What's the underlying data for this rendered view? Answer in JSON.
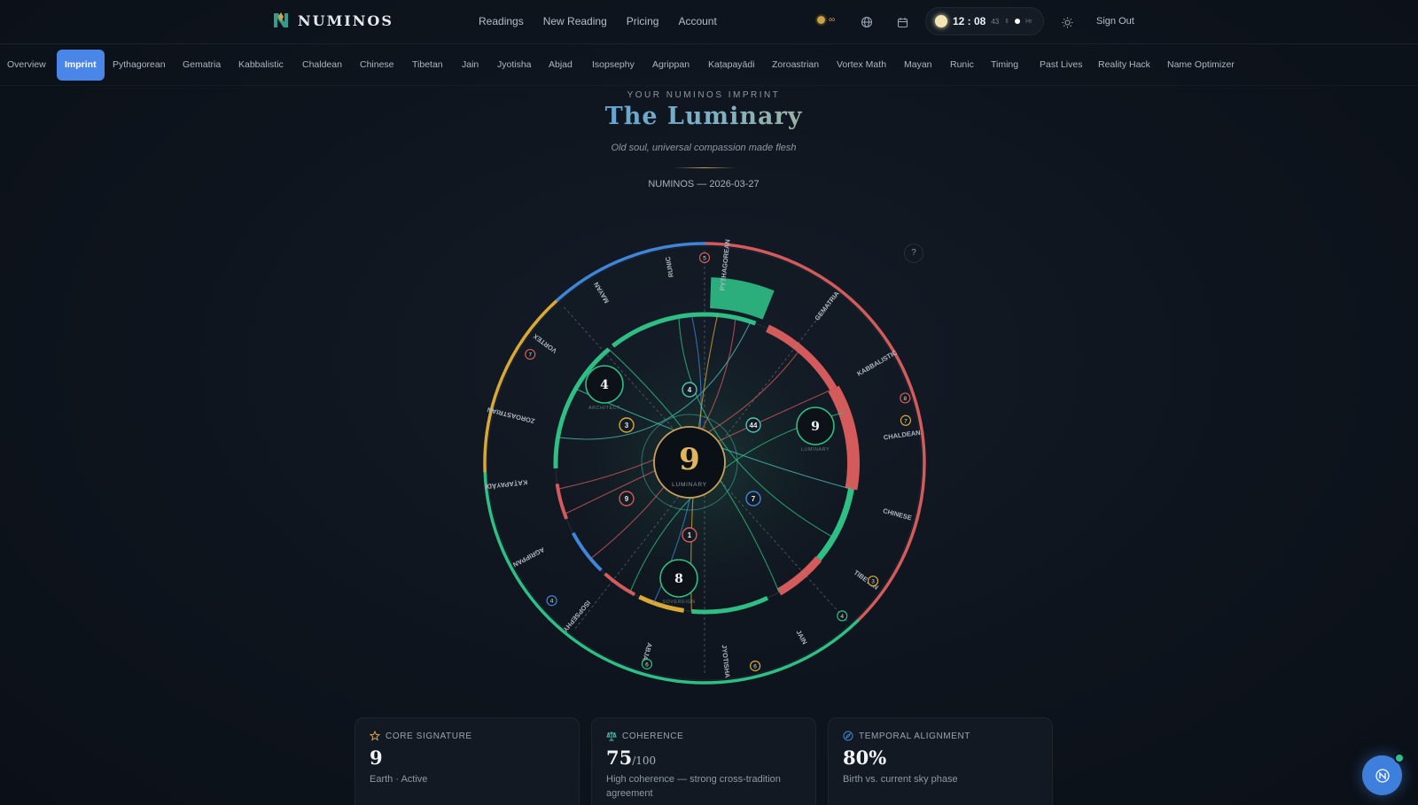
{
  "brand": {
    "name": "NUMINOS"
  },
  "nav": {
    "items": [
      "Readings",
      "New Reading",
      "Pricing",
      "Account"
    ]
  },
  "header": {
    "credits": "∞",
    "clock": {
      "time": "12 : 08",
      "seconds": "43",
      "hr_label": "Hr"
    },
    "sign_out": "Sign Out"
  },
  "tabs": {
    "active_index": 1,
    "items": [
      "Overview",
      "Imprint",
      "Pythagorean",
      "Gematria",
      "Kabbalistic",
      "Chaldean",
      "Chinese",
      "Tibetan",
      "Jain",
      "Jyotisha",
      "Abjad",
      "Isopsephy",
      "Agrippan",
      "Kaṭapayādi",
      "Zoroastrian",
      "Vortex Math",
      "Mayan",
      "Runic",
      "Timing",
      "Past Lives",
      "Reality Hack",
      "Name Optimizer"
    ]
  },
  "hero": {
    "eyebrow": "YOUR NUMINOS IMPRINT",
    "title": "The Luminary",
    "subtitle": "Old soul, universal compassion made flesh",
    "stamp": "NUMINOS — 2026-03-27"
  },
  "wheel": {
    "center": {
      "number": "9",
      "label": "LUMINARY"
    },
    "traditions": [
      "PYTHAGOREAN",
      "GEMATRIA",
      "KABBALISTIC",
      "CHALDEAN",
      "CHINESE",
      "TIBETAN",
      "JAIN",
      "JYOTISHA",
      "ABJAD",
      "ISOPSEPHY",
      "AGRIPPAN",
      "KAṬAPAYĀDI",
      "ZOROASTRIAN",
      "VORTEX",
      "MAYAN",
      "RUNIC"
    ],
    "satellites": [
      {
        "number": "4",
        "label": "ARCHITECT"
      },
      {
        "number": "9",
        "label": "LUMINARY"
      },
      {
        "number": "8",
        "label": "SOVEREIGN"
      }
    ],
    "inner_nodes": [
      "4",
      "3",
      "44",
      "9",
      "7",
      "1"
    ],
    "badges": [
      "5",
      "8",
      "7",
      "3",
      "4",
      "6",
      "6",
      "7",
      "4"
    ],
    "help": "?",
    "colors": {
      "red": "#d35b5b",
      "green": "#2fbf85",
      "blue": "#3f86d9",
      "gold": "#d8a935",
      "teal": "#4fc2b5"
    }
  },
  "cards": [
    {
      "icon": "star-icon",
      "title": "CORE SIGNATURE",
      "value": "9",
      "value_suffix": "",
      "desc": "Earth · Active"
    },
    {
      "icon": "scale-icon",
      "title": "COHERENCE",
      "value": "75",
      "value_suffix": "/100",
      "desc": "High coherence — strong cross-tradition agreement"
    },
    {
      "icon": "compass-icon",
      "title": "TEMPORAL ALIGNMENT",
      "value": "80%",
      "value_suffix": "",
      "desc": "Birth vs. current sky phase"
    }
  ]
}
